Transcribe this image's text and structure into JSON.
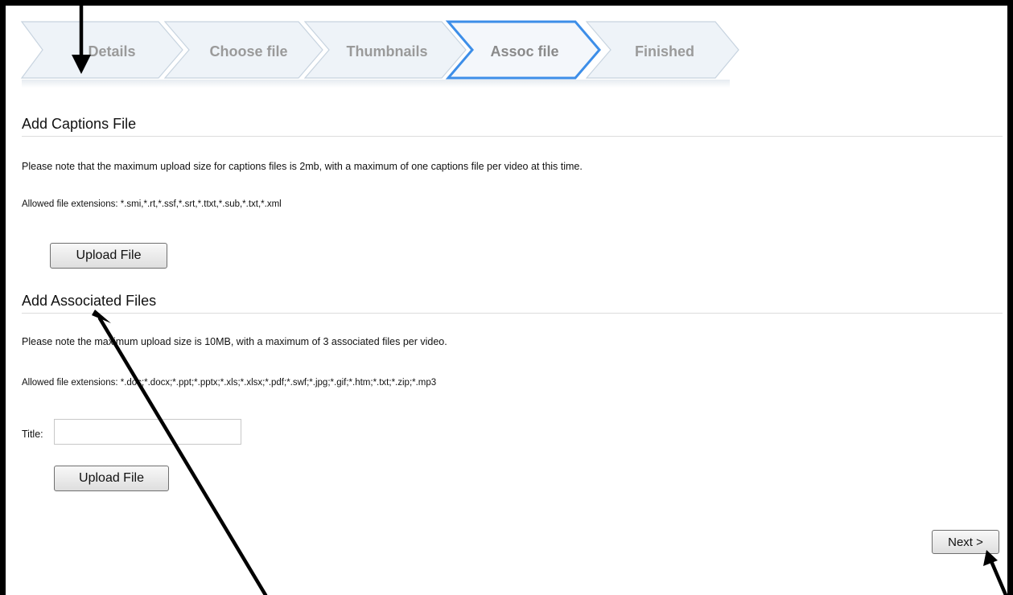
{
  "wizard": {
    "steps": [
      {
        "label": "Details",
        "active": false
      },
      {
        "label": "Choose file",
        "active": false
      },
      {
        "label": "Thumbnails",
        "active": false
      },
      {
        "label": "Assoc file",
        "active": true
      },
      {
        "label": "Finished",
        "active": false
      }
    ],
    "active_border_color": "#3d8ee8",
    "inactive_fill": "#eef3f8"
  },
  "captions": {
    "title": "Add Captions File",
    "note": "Please note that the maximum upload size for captions files is 2mb, with a maximum of one captions file per video at this time.",
    "extensions": "Allowed file extensions: *.smi,*.rt,*.ssf,*.srt,*.ttxt,*.sub,*.txt,*.xml",
    "upload_label": "Upload File"
  },
  "associated": {
    "title": "Add Associated Files",
    "note": "Please note the maximum upload size is 10MB, with a maximum of 3 associated files per video.",
    "extensions": "Allowed file extensions: *.doc;*.docx;*.ppt;*.pptx;*.xls;*.xlsx;*.pdf;*.swf;*.jpg;*.gif;*.htm;*.txt;*.zip;*.mp3",
    "title_label": "Title:",
    "title_value": "",
    "upload_label": "Upload File"
  },
  "footer": {
    "next_label": "Next >"
  },
  "annotations": {
    "arrow_color": "#000000",
    "arrows": [
      "pointing-to-details-step",
      "pointing-to-add-associated-files",
      "pointing-to-next-button"
    ]
  }
}
